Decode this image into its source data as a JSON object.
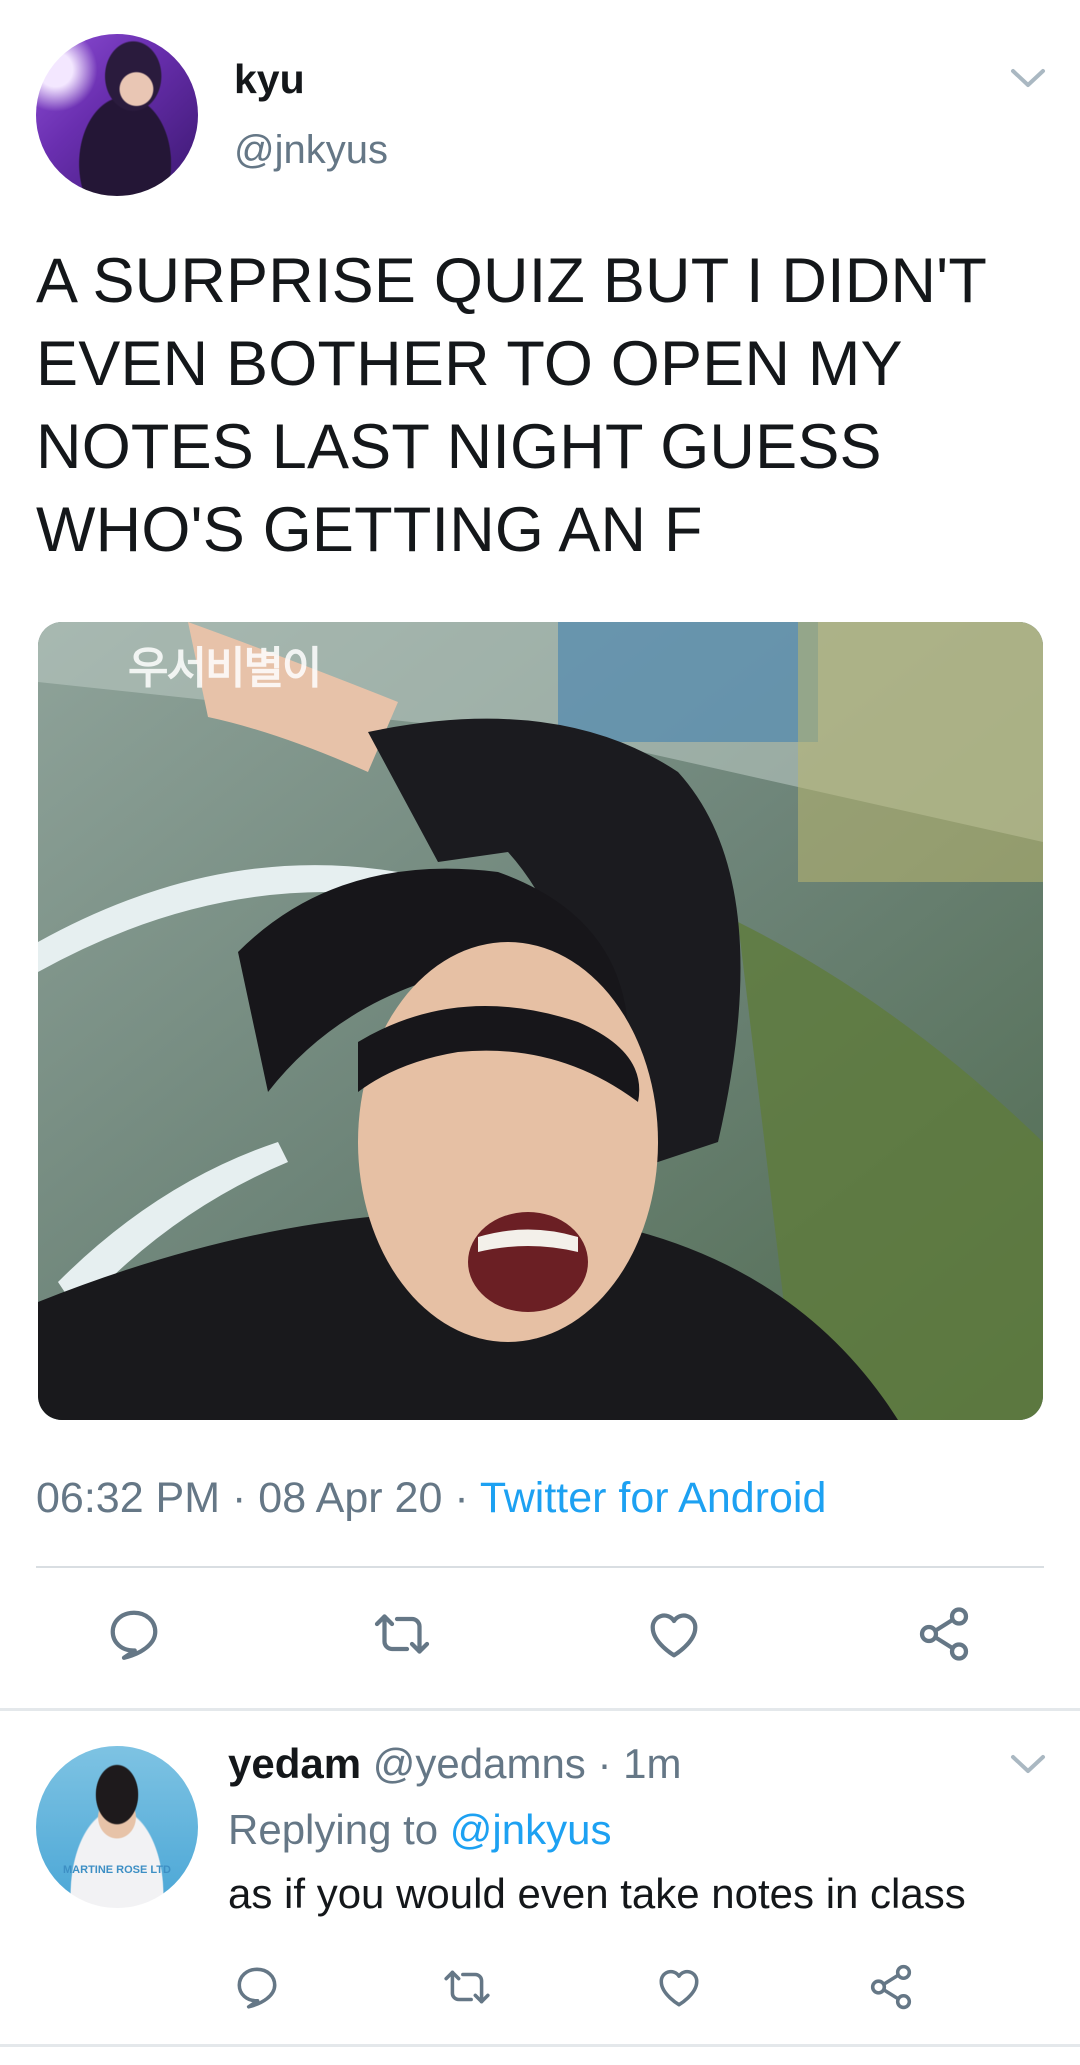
{
  "tweet": {
    "display_name": "kyu",
    "handle": "@jnkyus",
    "text": "A SURPRISE QUIZ BUT I DIDN'T EVEN BOTHER TO OPEN MY NOTES LAST NIGHT GUESS WHO'S GETTING AN F",
    "time": "06:32 PM",
    "sep1": " · ",
    "date": "08 Apr 20",
    "sep2": " · ",
    "source": "Twitter for Android",
    "media_overlay_text": "우서비별이"
  },
  "actions": {
    "icons": [
      "reply-icon",
      "retweet-icon",
      "like-icon",
      "share-icon"
    ]
  },
  "reply": {
    "display_name": "yedam",
    "handle": "@yedamns",
    "age": " · 1m",
    "replying_prefix": "Replying to ",
    "replying_to": "@jnkyus",
    "text": "as if you would even take notes in class",
    "avatar_shirt_text": "MARTINE ROSE LTD"
  },
  "colors": {
    "text": "#14171a",
    "secondary": "#657786",
    "link": "#1da1f2",
    "divider": "#d9dee2",
    "icon": "#657786"
  }
}
